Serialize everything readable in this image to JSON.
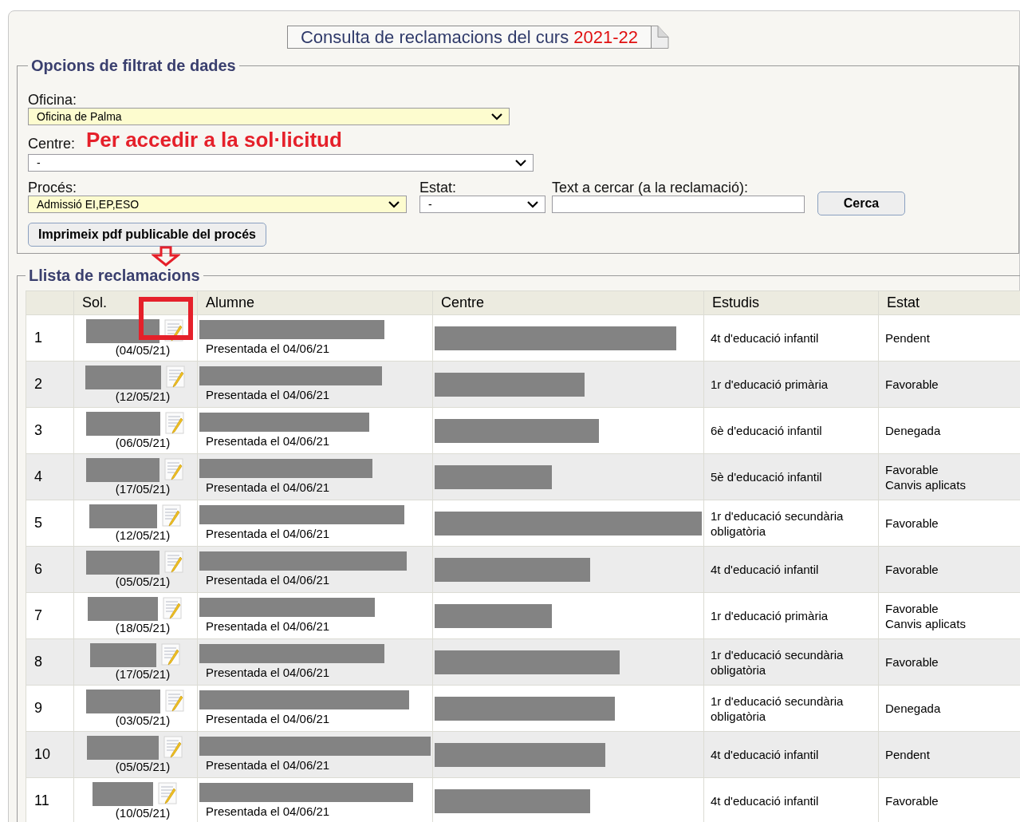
{
  "title": {
    "text": "Consulta de reclamacions del curs ",
    "year": "2021-22"
  },
  "filters": {
    "legend": "Opcions de filtrat de dades",
    "oficina": {
      "label": "Oficina:",
      "value": "Oficina de Palma"
    },
    "centre": {
      "label": "Centre:",
      "value": "-"
    },
    "proces": {
      "label": "Procés:",
      "value": "Admissió EI,EP,ESO"
    },
    "estat": {
      "label": "Estat:",
      "value": "-"
    },
    "search": {
      "label": "Text a cercar (a la reclamació):"
    },
    "search_button": "Cerca",
    "print_button": "Imprimeix pdf publicable del procés"
  },
  "annotation": {
    "text": "Per accedir a la sol·licitud"
  },
  "list": {
    "legend": "Llista de reclamacions",
    "columns": [
      "Sol.",
      "Alumne",
      "Centre",
      "Estudis",
      "Estat"
    ],
    "rows": [
      {
        "num": "1",
        "date": "(04/05/21)",
        "alumne": "Presentada el 04/06/21",
        "estudis": [
          "4t d'educació infantil"
        ],
        "estat": [
          "Pendent"
        ]
      },
      {
        "num": "2",
        "date": "(12/05/21)",
        "alumne": "Presentada el 04/06/21",
        "estudis": [
          "1r d'educació primària"
        ],
        "estat": [
          "Favorable"
        ]
      },
      {
        "num": "3",
        "date": "(06/05/21)",
        "alumne": "Presentada el 04/06/21",
        "estudis": [
          "6è d'educació infantil"
        ],
        "estat": [
          "Denegada"
        ]
      },
      {
        "num": "4",
        "date": "(17/05/21)",
        "alumne": "Presentada el 04/06/21",
        "estudis": [
          "5è d'educació infantil"
        ],
        "estat": [
          "Favorable",
          "Canvis aplicats"
        ]
      },
      {
        "num": "5",
        "date": "(12/05/21)",
        "alumne": "Presentada el 04/06/21",
        "estudis": [
          "1r d'educació secundària",
          "obligatòria"
        ],
        "estat": [
          "Favorable"
        ]
      },
      {
        "num": "6",
        "date": "(05/05/21)",
        "alumne": "Presentada el 04/06/21",
        "estudis": [
          "4t d'educació infantil"
        ],
        "estat": [
          "Favorable"
        ]
      },
      {
        "num": "7",
        "date": "(18/05/21)",
        "alumne": "Presentada el 04/06/21",
        "estudis": [
          "1r d'educació primària"
        ],
        "estat": [
          "Favorable",
          "Canvis aplicats"
        ]
      },
      {
        "num": "8",
        "date": "(17/05/21)",
        "alumne": "Presentada el 04/06/21",
        "estudis": [
          "1r d'educació secundària",
          "obligatòria"
        ],
        "estat": [
          "Favorable"
        ]
      },
      {
        "num": "9",
        "date": "(03/05/21)",
        "alumne": "Presentada el 04/06/21",
        "estudis": [
          "1r d'educació secundària",
          "obligatòria"
        ],
        "estat": [
          "Denegada"
        ]
      },
      {
        "num": "10",
        "date": "(05/05/21)",
        "alumne": "Presentada el 04/06/21",
        "estudis": [
          "4t d'educació infantil"
        ],
        "estat": [
          "Pendent"
        ]
      },
      {
        "num": "11",
        "date": "(10/05/21)",
        "alumne": "Presentada el 04/06/21",
        "estudis": [
          "4t d'educació infantil"
        ],
        "estat": [
          "Favorable"
        ]
      }
    ]
  }
}
